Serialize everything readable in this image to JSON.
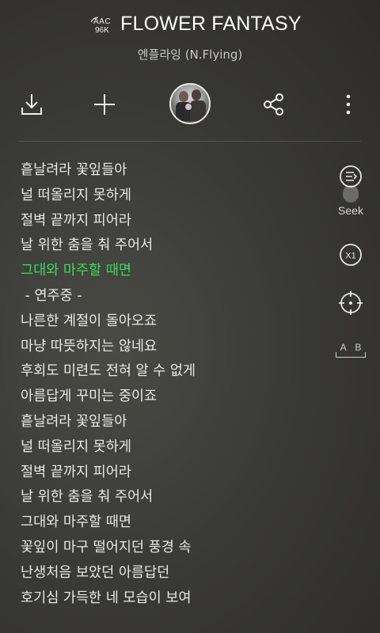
{
  "header": {
    "codec_top": "AAC",
    "codec_bottom": "96K",
    "song_title": "FLOWER FANTASY",
    "artist": "엔플라잉 (N.Flying)"
  },
  "toolbar": {
    "download_icon": "download-icon",
    "add_icon": "plus-icon",
    "album_icon": "album-thumbnail",
    "share_icon": "share-icon",
    "more_icon": "more-vertical-icon"
  },
  "lyrics": [
    "흩날려라 꽃잎들아",
    "널 떠올리지 못하게",
    "절벽 끝까지 피어라",
    "날 위한 춤을 춰 주어서",
    "그대와 마주할 때면",
    " - 연주중 -",
    "나른한 계절이 돌아오죠",
    "마냥 따뜻하지는 않네요",
    "후회도 미련도 전혀 알 수 없게",
    "아름답게 꾸미는 중이죠",
    "흩날려라 꽃잎들아",
    "널 떠올리지 못하게",
    "절벽 끝까지 피어라",
    "날 위한 춤을 춰 주어서",
    "그대와 마주할 때면",
    "꽃잎이 마구 떨어지던 풍경 속",
    "난생처음 보았던 아름답던",
    "호기심 가득한 네 모습이 보여"
  ],
  "current_line_index": 4,
  "side": {
    "seek_label": "Seek",
    "speed_label": "X1",
    "ab_label": "A B"
  },
  "colors": {
    "highlight": "#3ddc5a",
    "text": "#e8e8e6"
  }
}
